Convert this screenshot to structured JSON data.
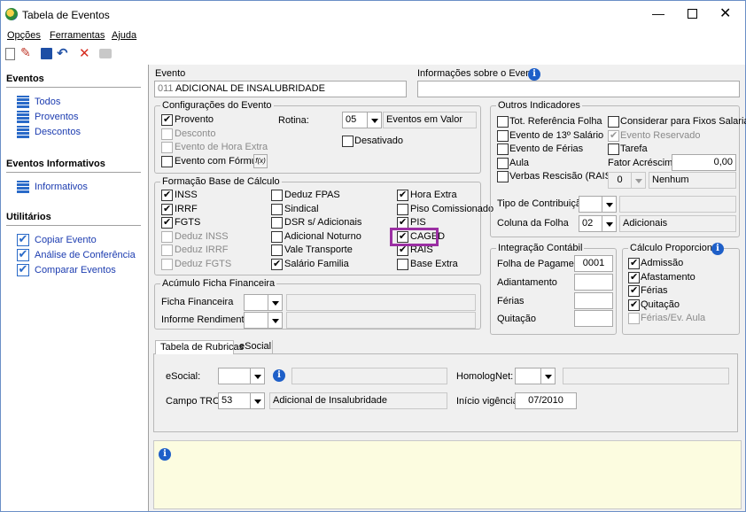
{
  "window": {
    "title": "Tabela de Eventos"
  },
  "menu": {
    "opcoes": "Opções",
    "ferramentas": "Ferramentas",
    "ajuda": "Ajuda"
  },
  "sidebar": {
    "eventos_header": "Eventos",
    "eventos_items": [
      {
        "label": "Todos"
      },
      {
        "label": "Proventos"
      },
      {
        "label": "Descontos"
      }
    ],
    "informativos_header": "Eventos Informativos",
    "informativos_items": [
      {
        "label": "Informativos"
      }
    ],
    "utilitarios_header": "Utilitários",
    "utilitarios_items": [
      {
        "label": "Copiar Evento"
      },
      {
        "label": "Análise de Conferência"
      },
      {
        "label": "Comparar Eventos"
      }
    ]
  },
  "evento": {
    "label": "Evento",
    "code": "011",
    "name": "ADICIONAL DE INSALUBRIDADE",
    "info_label": "Informações sobre o Evento",
    "info_value": ""
  },
  "config": {
    "title": "Configurações do Evento",
    "provento": {
      "label": "Provento",
      "checked": true
    },
    "desconto": {
      "label": "Desconto",
      "checked": false
    },
    "hora_extra": {
      "label": "Evento de Hora Extra",
      "checked": false
    },
    "formula": {
      "label": "Evento com Fórmula",
      "checked": false,
      "button": "f(x)"
    },
    "rotina_label": "Rotina:",
    "rotina_value": "05",
    "rotina_desc": "Eventos em Valor",
    "desativado": {
      "label": "Desativado",
      "checked": false
    }
  },
  "formacao": {
    "title": "Formação Base de Cálculo",
    "items": [
      {
        "label": "INSS",
        "checked": true,
        "enabled": true
      },
      {
        "label": "IRRF",
        "checked": true,
        "enabled": true
      },
      {
        "label": "FGTS",
        "checked": true,
        "enabled": true
      },
      {
        "label": "Deduz INSS",
        "checked": false,
        "enabled": false
      },
      {
        "label": "Deduz IRRF",
        "checked": false,
        "enabled": false
      },
      {
        "label": "Deduz FGTS",
        "checked": false,
        "enabled": false
      },
      {
        "label": "Deduz FPAS",
        "checked": false,
        "enabled": true
      },
      {
        "label": "Sindical",
        "checked": false,
        "enabled": true
      },
      {
        "label": "DSR s/ Adicionais",
        "checked": false,
        "enabled": true
      },
      {
        "label": "Adicional Noturno",
        "checked": false,
        "enabled": true
      },
      {
        "label": "Vale Transporte",
        "checked": false,
        "enabled": true
      },
      {
        "label": "Salário Familia",
        "checked": true,
        "enabled": true
      },
      {
        "label": "Hora Extra",
        "checked": true,
        "enabled": true
      },
      {
        "label": "Piso Comissionado",
        "checked": false,
        "enabled": true
      },
      {
        "label": "PIS",
        "checked": true,
        "enabled": true
      },
      {
        "label": "CAGED",
        "checked": true,
        "enabled": true
      },
      {
        "label": "RAIS",
        "checked": true,
        "enabled": true
      },
      {
        "label": "Base Extra",
        "checked": false,
        "enabled": true
      }
    ]
  },
  "acumulo": {
    "title": "Acúmulo Ficha Financeira",
    "ficha_label": "Ficha Financeira",
    "informe_label": "Informe Rendimentos"
  },
  "outros": {
    "title": "Outros Indicadores",
    "left": [
      {
        "label": "Tot. Referência Folha",
        "checked": false
      },
      {
        "label": "Evento de 13º Salário",
        "checked": false
      },
      {
        "label": "Evento de Férias",
        "checked": false
      },
      {
        "label": "Aula",
        "checked": false
      },
      {
        "label": "Verbas Rescisão (RAIS)",
        "checked": false
      }
    ],
    "right": [
      {
        "label": "Considerar para Fixos Salariais",
        "checked": false,
        "enabled": true
      },
      {
        "label": "Evento Reservado",
        "checked": true,
        "enabled": false
      },
      {
        "label": "Tarefa",
        "checked": false,
        "enabled": true
      }
    ],
    "fator_label": "Fator Acréscimo",
    "fator_value": "0,00",
    "nenhum_value": "0",
    "nenhum_desc": "Nenhum",
    "tipo_label": "Tipo de Contribuição",
    "coluna_label": "Coluna da Folha",
    "coluna_value": "02",
    "coluna_desc": "Adicionais"
  },
  "integracao": {
    "title": "Integração Contábil",
    "folha_label": "Folha de Pagamento",
    "folha_value": "0001",
    "adiantamento_label": "Adiantamento",
    "ferias_label": "Férias",
    "quitacao_label": "Quitação"
  },
  "calculo": {
    "title": "Cálculo Proporcional",
    "items": [
      {
        "label": "Admissão",
        "checked": true,
        "enabled": true
      },
      {
        "label": "Afastamento",
        "checked": true,
        "enabled": true
      },
      {
        "label": "Férias",
        "checked": true,
        "enabled": true
      },
      {
        "label": "Quitação",
        "checked": true,
        "enabled": true
      },
      {
        "label": "Férias/Ev. Aula",
        "checked": false,
        "enabled": false
      }
    ]
  },
  "tabs": [
    {
      "label": "Tabela de Rubricas"
    },
    {
      "label": "eSocial"
    }
  ],
  "rubricas": {
    "esocial_label": "eSocial:",
    "homolognet_label": "HomologNet:",
    "trct_label": "Campo TRCT:",
    "trct_value": "53",
    "trct_desc": "Adicional de Insalubridade",
    "inicio_label": "Início vigência:",
    "inicio_value": "07/2010"
  },
  "colors": {
    "accent": "#1c3cb0",
    "highlight": "#9b2fa3",
    "notes_bg": "#fcfce0"
  }
}
